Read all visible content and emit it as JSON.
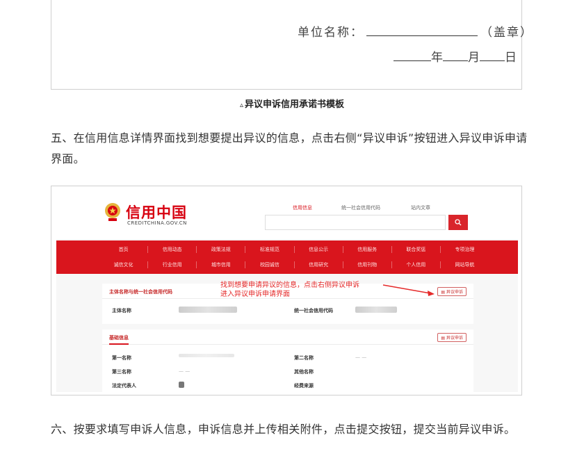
{
  "template": {
    "unit_label": "单位名称：",
    "seal_label": "（盖章）",
    "year_label": "年",
    "month_label": "月",
    "day_label": "日"
  },
  "caption": "异议申诉信用承诺书模板",
  "step5": "五、在信用信息详情界面找到想要提出异议的信息，点击右侧“异议申诉”按钮进入异议申诉申请界面。",
  "step6": "六、按要求填写申诉人信息，申诉信息并上传相关附件，点击提交按钮，提交当前异议申诉。",
  "site": {
    "logo_cn": "信用中国",
    "logo_en": "CREDITCHINA.GOV.CN",
    "tabs": [
      "信用信息",
      "统一社会信用代码",
      "站内文章"
    ],
    "search_icon": "search-icon",
    "nav_row1": [
      "首页",
      "信用动态",
      "政策法规",
      "标准规范",
      "信息公示",
      "信用服务",
      "联合奖惩",
      "专项治理"
    ],
    "nav_row2": [
      "诚信文化",
      "行业信用",
      "城市信用",
      "校园诚信",
      "信用研究",
      "信用刊物",
      "个人信用",
      "网站导航"
    ],
    "panel1_title": "主体名称与统一社会信用代码",
    "dispute_button": "异议申诉",
    "entity_name_label": "主体名称",
    "credit_code_label": "统一社会信用代码",
    "panel2_title": "基础信息",
    "fields_left": [
      "第一名称",
      "第三名称",
      "法定代表人"
    ],
    "fields_right": [
      "第二名称",
      "其他名称",
      "经费来源"
    ],
    "dash_value": "— —",
    "annotation_line1": "找到想要申请异议的信息，点击右侧异议申诉",
    "annotation_line2": "进入异议申诉申请界面",
    "accent_color": "#d9151d"
  }
}
